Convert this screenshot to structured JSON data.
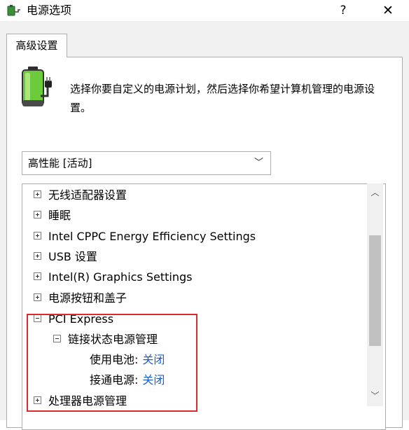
{
  "window": {
    "title": "电源选项",
    "help_label": "?",
    "close_label": "✕"
  },
  "tabs": [
    {
      "label": "高级设置"
    }
  ],
  "description": "选择你要自定义的电源计划，然后选择你希望计算机管理的电源设置。",
  "plan_select": {
    "selected": "高性能 [活动]",
    "chevron": "﹀"
  },
  "tree": {
    "items": [
      {
        "label": "无线适配器设置",
        "expander": "plus"
      },
      {
        "label": "睡眠",
        "expander": "plus"
      },
      {
        "label": "Intel CPPC Energy Efficiency Settings",
        "expander": "plus"
      },
      {
        "label": "USB 设置",
        "expander": "plus"
      },
      {
        "label": "Intel(R) Graphics Settings",
        "expander": "plus"
      },
      {
        "label": "电源按钮和盖子",
        "expander": "plus"
      },
      {
        "label": "PCI Express",
        "expander": "minus"
      },
      {
        "label": "链接状态电源管理",
        "expander": "minus"
      },
      {
        "label": "使用电池:",
        "value": "关闭"
      },
      {
        "label": "接通电源:",
        "value": "关闭"
      },
      {
        "label": "处理器电源管理",
        "expander": "plus"
      }
    ]
  },
  "scrollbar": {
    "up_arrow": "︿",
    "down_arrow": "﹀"
  },
  "colors": {
    "highlight_border": "#e0282e",
    "value_link": "#1a5fc9"
  }
}
